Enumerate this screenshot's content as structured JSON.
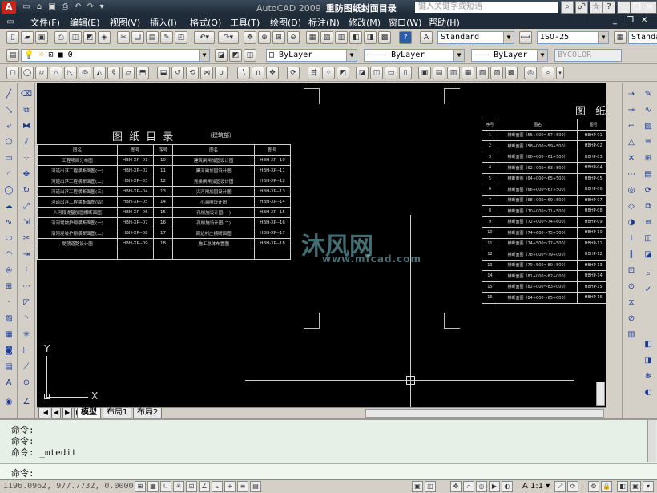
{
  "window": {
    "app_name": "AutoCAD 2009",
    "doc_name": "重防图纸封面目录",
    "search_placeholder": "键入关键字或短语",
    "logo_letter": "A"
  },
  "menu": [
    "文件(F)",
    "编辑(E)",
    "视图(V)",
    "插入(I)",
    "格式(O)",
    "工具(T)",
    "绘图(D)",
    "标注(N)",
    "修改(M)",
    "窗口(W)",
    "帮助(H)"
  ],
  "toolbar": {
    "text_style": "Standard",
    "dim_style": "ISO-25",
    "table_style": "Standard",
    "layer": "0",
    "color": "ByLayer",
    "linetype": "ByLayer",
    "lineweight": "ByLayer",
    "plotstyle": "BYCOLOR"
  },
  "drawing": {
    "left_title": "图  纸  目  录",
    "left_subtitle": "（建筑部）",
    "right_title": "图  纸",
    "left_table": {
      "headers": [
        "图名",
        "图号",
        "序号",
        "图名",
        "图号"
      ],
      "rows": [
        [
          "工程项目分布图",
          "HBH-XP--01",
          "10",
          "建筑闸闸加固设计图",
          "HBH-XP--10"
        ],
        [
          "河道出浮工程横断面图(一)",
          "HBH-XP--02",
          "11",
          "黑河闸加固设计图",
          "HBH-XP--11"
        ],
        [
          "河道出浮工程横断面图(二)",
          "HBH-XP--03",
          "12",
          "尧桑闸闸加固设计图",
          "HBH-XP--12"
        ],
        [
          "河道出浮工程横断面图(三)",
          "HBH-XP--04",
          "13",
          "尖河闸加固设计图",
          "HBH-XP--13"
        ],
        [
          "河道出浮工程横断面图(四)",
          "HBH-XP--05",
          "14",
          "小涵闸设计图",
          "HBH-XP--14"
        ],
        [
          "人河段堤基加固横断面图",
          "HBH-XP--06",
          "15",
          "孔桥施设计图(一)",
          "HBH-XP--15"
        ],
        [
          "沿河堤坡护砌横断面图(一)",
          "HBH-XP--07",
          "16",
          "孔桥施设计图(二)",
          "HBH-XP--16"
        ],
        [
          "沿河堤坡护砌横断面图(二)",
          "HBH-XP--08",
          "17",
          "周边村庄横断面图",
          "HBH-XP--17"
        ],
        [
          "堤顶道路设计图",
          "HBH-XP--09",
          "18",
          "施工总体布置图",
          "HBH-XP--18"
        ],
        [
          "",
          "",
          "",
          "",
          ""
        ]
      ]
    },
    "right_table": {
      "headers": [
        "序号",
        "图名",
        "图号"
      ],
      "rows": [
        [
          "1",
          "横断面图（56+000～57+500）",
          "HBHP-01"
        ],
        [
          "2",
          "横断面图（58+000～59+500）",
          "HBHP-02"
        ],
        [
          "3",
          "横断面图（60+000～61+500）",
          "HBHP-03"
        ],
        [
          "4",
          "横断面图（62+000～63+500）",
          "HBHP-04"
        ],
        [
          "5",
          "横断面图（64+000～65+500）",
          "HBHP-05"
        ],
        [
          "6",
          "横断面图（66+000～67+500）",
          "HBHP-06"
        ],
        [
          "7",
          "横断面图（68+000～69+500）",
          "HBHP-07"
        ],
        [
          "8",
          "横断面图（70+000～71+500）",
          "HBHP-08"
        ],
        [
          "9",
          "横断面图（72+000～74+600）",
          "HBHP-09"
        ],
        [
          "10",
          "横断面图（74+600～75+500）",
          "HBHP-10"
        ],
        [
          "11",
          "横断面图（74+500～77+500）",
          "HBHP-11"
        ],
        [
          "12",
          "横断面图（78+000～79+000）",
          "HBHP-12"
        ],
        [
          "13",
          "横断面图（79+500～80+500）",
          "HBHP-13"
        ],
        [
          "14",
          "横断面图（81+000～82+000）",
          "HBHP-14"
        ],
        [
          "15",
          "横断面图（82+000～83+000）",
          "HBHP-15"
        ],
        [
          "16",
          "横断面图（84+000～85+000）",
          "HBHP-16"
        ]
      ]
    },
    "ucs_x": "X",
    "ucs_y": "Y",
    "watermark": "沐风网",
    "watermark_url": "www.mfcad.com"
  },
  "layout_tabs": [
    "模型",
    "布局1",
    "布局2"
  ],
  "command": {
    "lines": [
      "命令:",
      "命令:",
      "命令: _mtedit"
    ],
    "prompt": "命令:"
  },
  "status": {
    "coords": "1196.0962, 977.7732, 0.0000",
    "scale": "1:1"
  }
}
